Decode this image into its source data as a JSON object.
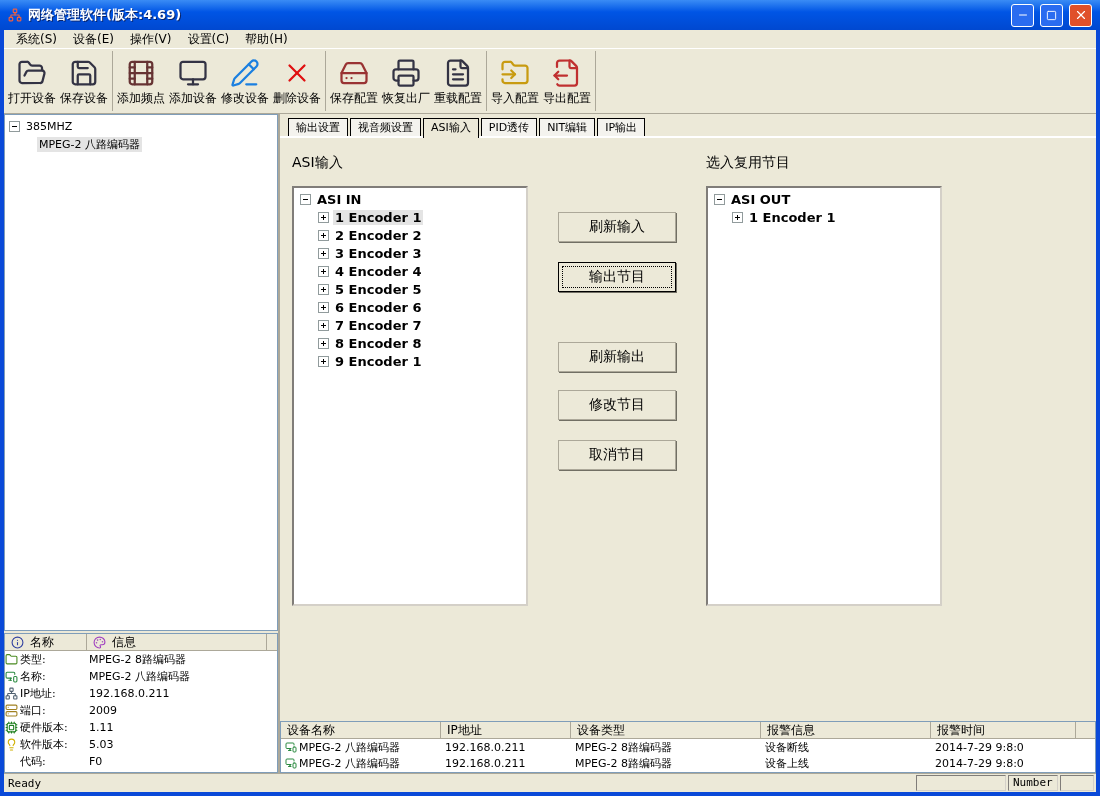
{
  "window": {
    "title": "网络管理软件(版本:4.69)"
  },
  "menu": [
    "系统(S)",
    "设备(E)",
    "操作(V)",
    "设置(C)",
    "帮助(H)"
  ],
  "toolbar": [
    [
      "打开设备",
      "保存设备"
    ],
    [
      "添加频点",
      "添加设备",
      "修改设备",
      "删除设备"
    ],
    [
      "保存配置",
      "恢复出厂",
      "重载配置"
    ],
    [
      "导入配置",
      "导出配置"
    ]
  ],
  "device_tree": [
    {
      "label": "385MHZ",
      "expanded": true,
      "selected": false,
      "children": [
        {
          "label": "MPEG-2 八路编码器",
          "selected": true
        }
      ]
    }
  ],
  "info": {
    "columns": [
      "名称",
      "信息"
    ],
    "rows": [
      {
        "label": "类型:",
        "value": "MPEG-2 8路编码器"
      },
      {
        "label": "名称:",
        "value": "MPEG-2 八路编码器"
      },
      {
        "label": "IP地址:",
        "value": "192.168.0.211"
      },
      {
        "label": "端口:",
        "value": "2009"
      },
      {
        "label": "硬件版本:",
        "value": "1.11"
      },
      {
        "label": "软件版本:",
        "value": "5.03"
      },
      {
        "label": "代码:",
        "value": "F0"
      }
    ]
  },
  "tabs": [
    {
      "label": "输出设置",
      "selected": false
    },
    {
      "label": "视音频设置",
      "selected": false
    },
    {
      "label": "ASI输入",
      "selected": true
    },
    {
      "label": "PID透传",
      "selected": false
    },
    {
      "label": "NIT编辑",
      "selected": false
    },
    {
      "label": "IP输出",
      "selected": false
    }
  ],
  "asi_input": {
    "title": "ASI输入",
    "tree": [
      {
        "label": "ASI IN",
        "expanded": true,
        "selected": false,
        "children": [
          {
            "label": "1 Encoder 1",
            "expanded": false,
            "selected": true
          },
          {
            "label": "2 Encoder 2",
            "expanded": false,
            "selected": false
          },
          {
            "label": "3 Encoder 3",
            "expanded": false,
            "selected": false
          },
          {
            "label": "4 Encoder 4",
            "expanded": false,
            "selected": false
          },
          {
            "label": "5 Encoder 5",
            "expanded": false,
            "selected": false
          },
          {
            "label": "6 Encoder 6",
            "expanded": false,
            "selected": false
          },
          {
            "label": "7 Encoder 7",
            "expanded": false,
            "selected": false
          },
          {
            "label": "8 Encoder 8",
            "expanded": false,
            "selected": false
          },
          {
            "label": "9 Encoder 1",
            "expanded": false,
            "selected": false
          }
        ]
      }
    ]
  },
  "actions": [
    {
      "label": "刷新输入",
      "focused": false
    },
    {
      "label": "输出节目",
      "focused": true
    },
    {
      "label": "刷新输出",
      "focused": false
    },
    {
      "label": "修改节目",
      "focused": false
    },
    {
      "label": "取消节目",
      "focused": false
    }
  ],
  "mux_output": {
    "title": "选入复用节目",
    "tree": [
      {
        "label": "ASI OUT",
        "expanded": true,
        "selected": false,
        "children": [
          {
            "label": "1 Encoder 1",
            "expanded": false,
            "selected": false
          }
        ]
      }
    ]
  },
  "alarm_table": {
    "columns": [
      "设备名称",
      "IP地址",
      "设备类型",
      "报警信息",
      "报警时间"
    ],
    "rows": [
      [
        "MPEG-2 八路编码器",
        "192.168.0.211",
        "MPEG-2 8路编码器",
        "设备断线",
        "2014-7-29 9:8:0"
      ],
      [
        "MPEG-2 八路编码器",
        "192.168.0.211",
        "MPEG-2 8路编码器",
        "设备上线",
        "2014-7-29 9:8:0"
      ]
    ]
  },
  "status_bar": {
    "message": "Ready",
    "indicator": "Number"
  }
}
